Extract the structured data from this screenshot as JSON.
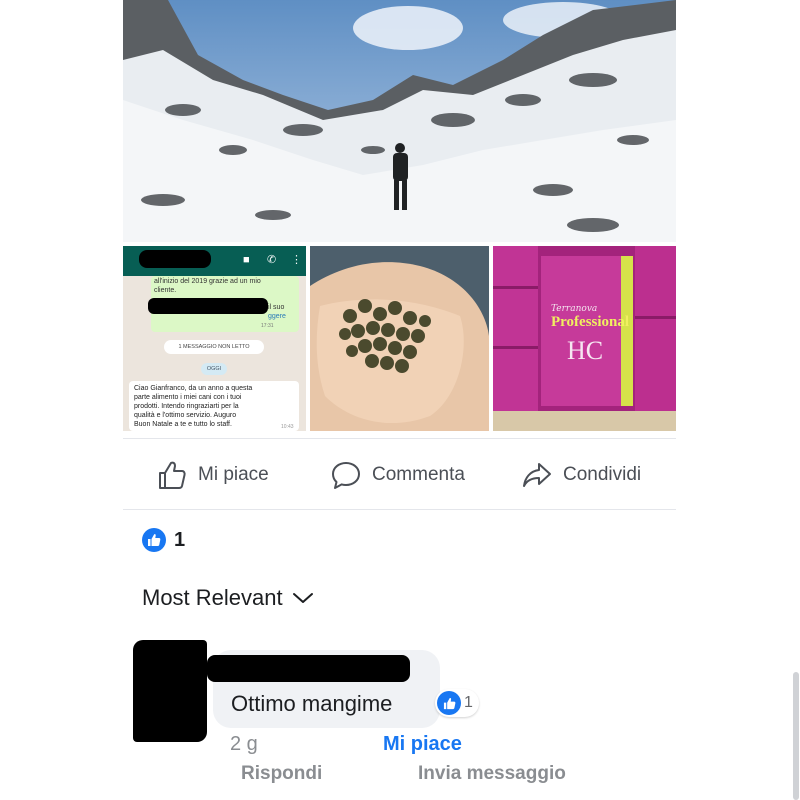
{
  "post": {
    "images": {
      "hero": "mountain-snow-hiker-photo",
      "chat": {
        "line_top": "all'inizio del 2019 grazie ad un mio",
        "line_top2": "cliente.",
        "line_mid": "il suo",
        "line_link": "ggere",
        "time": "17:31",
        "unread": "1 MESSAGGIO NON LETTO",
        "day": "OGGI",
        "incoming": "Ciao Gianfranco, da un anno a questa\nparte alimento i miei cani con i tuoi\nprodotti. Intendo ringraziarti per la\nqualità e l'ottimo servizio. Auguro\nBuon Natale a te e tutto lo staff.",
        "incoming_time": "10:43"
      },
      "hand": "hand-holding-kibble-photo",
      "bags": {
        "brand": "Terranova",
        "line": "Professional",
        "product": "HC"
      }
    },
    "actions": {
      "like_label": "Mi piace",
      "comment_label": "Commenta",
      "share_label": "Condividi"
    },
    "reactions": {
      "count": "1"
    },
    "sort": {
      "label": "Most Relevant"
    },
    "comment": {
      "text": "Ottimo mangime",
      "reaction_count": "1",
      "time": "2 g",
      "like_label": "Mi piace",
      "reply_label": "Rispondi",
      "message_label": "Invia messaggio"
    }
  },
  "colors": {
    "accent": "#1877f2",
    "muted": "#8a8d91",
    "text": "#1c1e21"
  }
}
